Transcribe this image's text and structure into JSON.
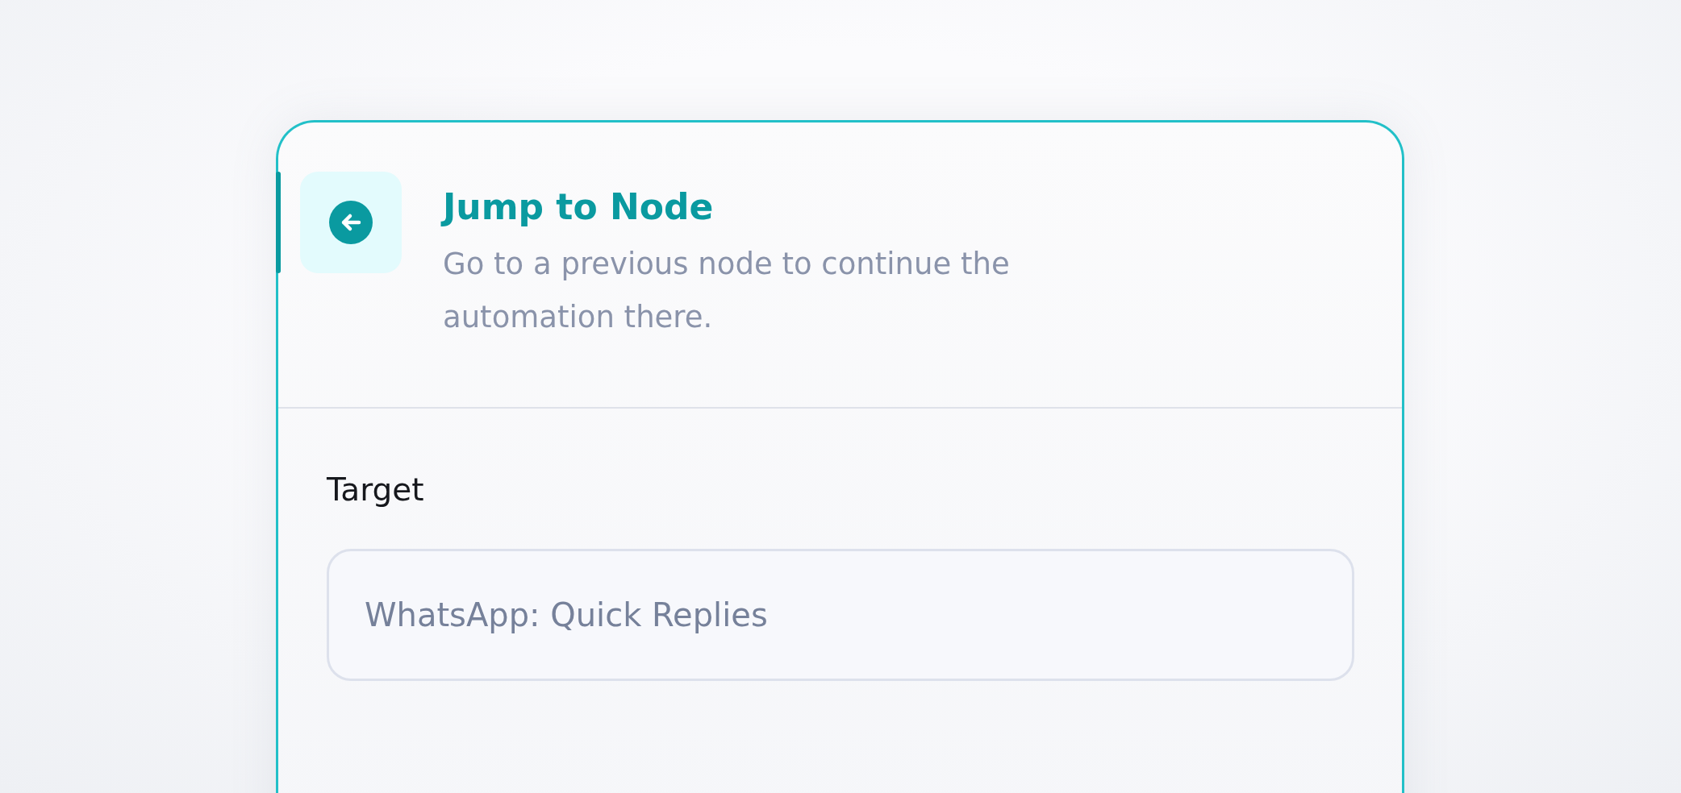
{
  "card": {
    "title": "Jump to Node",
    "description": "Go to a previous node to continue the automation there.",
    "field": {
      "label": "Target",
      "value": "WhatsApp: Quick Replies"
    }
  }
}
